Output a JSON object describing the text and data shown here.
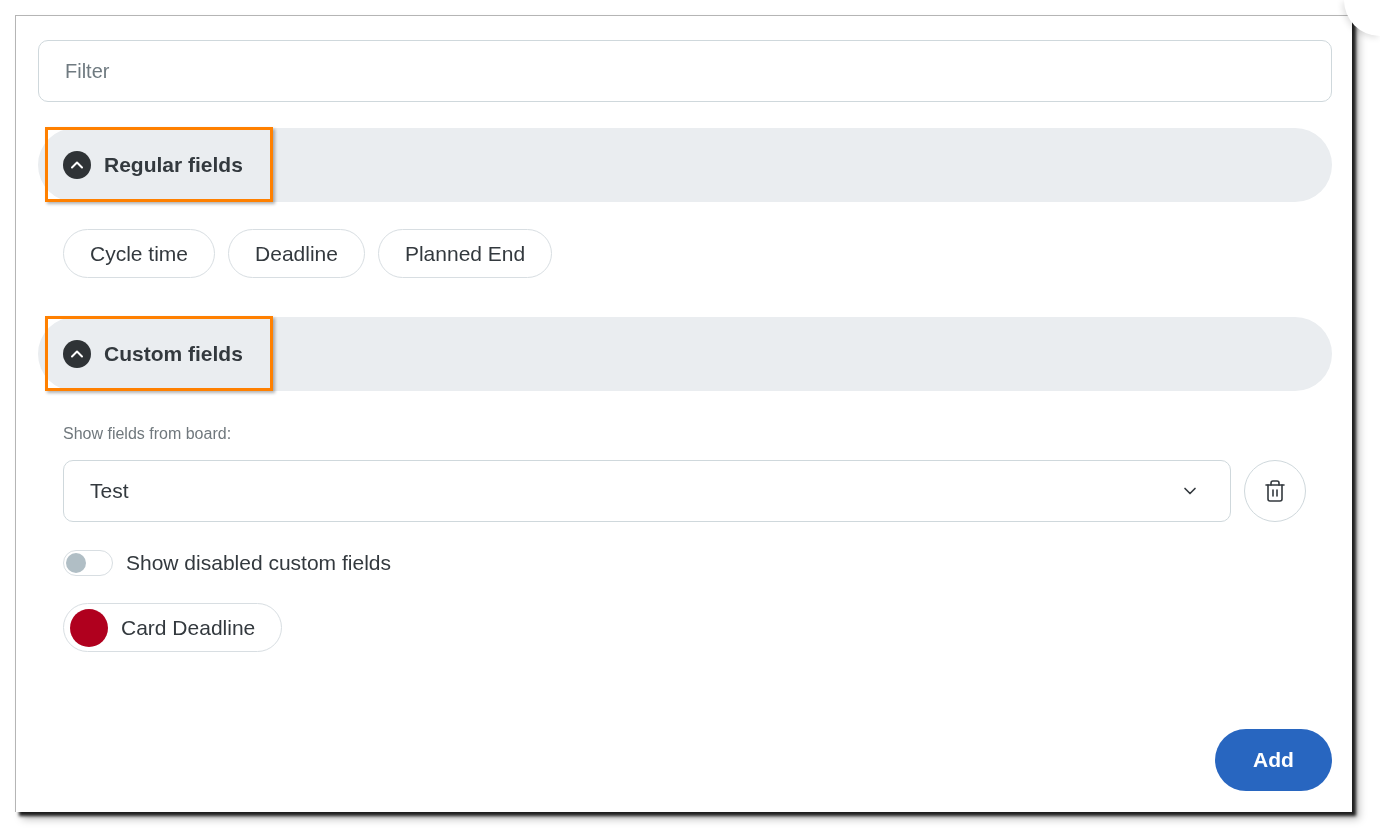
{
  "filter": {
    "placeholder": "Filter"
  },
  "sections": [
    {
      "kind": "chips",
      "title": "Regular fields",
      "expanded": true,
      "highlighted": true,
      "chips": [
        {
          "label": "Cycle time"
        },
        {
          "label": "Deadline"
        },
        {
          "label": "Planned End"
        }
      ]
    },
    {
      "kind": "custom",
      "title": "Custom fields",
      "expanded": true,
      "highlighted": true,
      "board_label": "Show fields from board:",
      "board_select": {
        "value": "Test"
      },
      "toggle": {
        "label": "Show disabled custom fields",
        "on": false
      },
      "chips": [
        {
          "label": "Card Deadline",
          "color": "#b0001e"
        }
      ]
    }
  ],
  "add_button": "Add"
}
